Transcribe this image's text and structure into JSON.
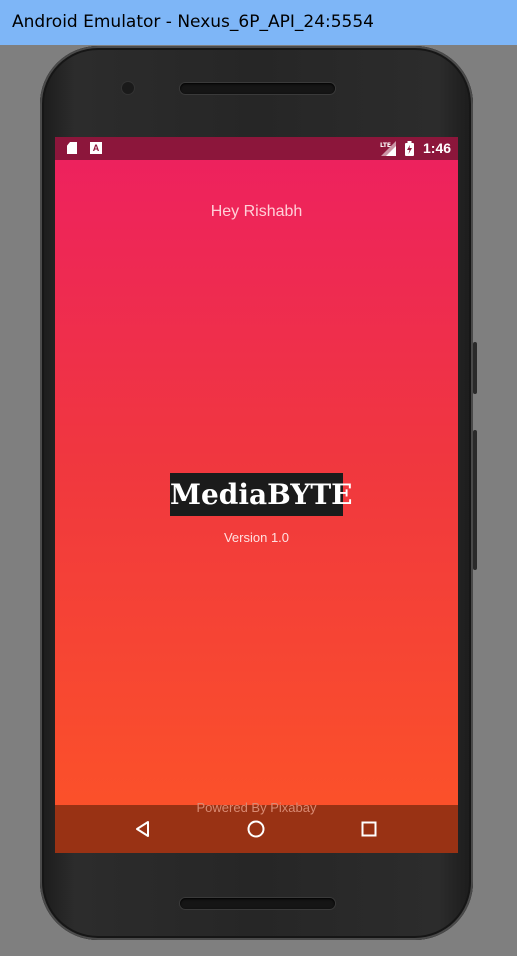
{
  "window": {
    "title": "Android Emulator - Nexus_6P_API_24:5554"
  },
  "statusbar": {
    "time": "1:46",
    "icons": [
      "sd-card-icon",
      "a-notification-icon",
      "lte-signal-icon",
      "battery-charging-icon"
    ],
    "a_icon_letter": "A",
    "color": "#8c163b"
  },
  "app": {
    "greeting": "Hey Rishabh",
    "brand": "MediaBYTE",
    "version": "Version 1.0",
    "powered_by": "Powered By Pixabay",
    "gradient": [
      "#ed2060",
      "#f0373f",
      "#fd5427"
    ]
  },
  "navbar": {
    "buttons": [
      "back-icon",
      "home-icon",
      "recents-icon"
    ],
    "color": "#993214"
  }
}
